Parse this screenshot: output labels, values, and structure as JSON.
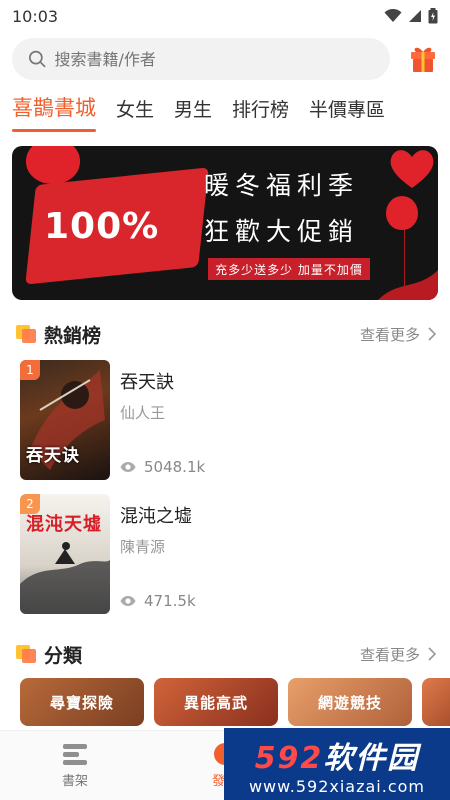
{
  "status": {
    "time": "10:03"
  },
  "search": {
    "placeholder": "搜索書籍/作者"
  },
  "tabs": [
    {
      "label": "喜鵲書城",
      "active": true
    },
    {
      "label": "女生",
      "active": false
    },
    {
      "label": "男生",
      "active": false
    },
    {
      "label": "排行榜",
      "active": false
    },
    {
      "label": "半價專區",
      "active": false
    }
  ],
  "banner": {
    "percent": "100%",
    "line1": "暖冬福利季",
    "line2": "狂歡大促銷",
    "sub": "充多少送多少 加量不加價"
  },
  "hot": {
    "title": "熱銷榜",
    "more": "查看更多",
    "books": [
      {
        "rank": "1",
        "title": "吞天訣",
        "author": "仙人王",
        "views": "5048.1k",
        "cover_text": "吞天诀"
      },
      {
        "rank": "2",
        "title": "混沌之墟",
        "author": "陳青源",
        "views": "471.5k",
        "cover_text": "混沌天墟"
      }
    ]
  },
  "categories": {
    "title": "分類",
    "more": "查看更多",
    "items": [
      "尋寶探險",
      "異能高武",
      "網遊競技"
    ]
  },
  "bottom_nav": [
    {
      "label": "書架"
    },
    {
      "label": "發現"
    }
  ],
  "watermark": {
    "main_num": "592",
    "main_text": "软件园",
    "url": "www.592xiazai.com"
  },
  "colors": {
    "accent": "#f0602e",
    "banner_bg": "#141414",
    "banner_red": "#d9262c"
  }
}
